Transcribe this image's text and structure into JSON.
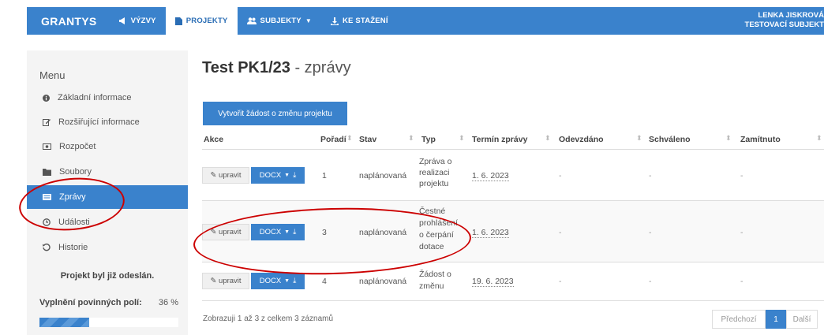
{
  "navbar": {
    "brand": "GRANTYS",
    "items": [
      {
        "label": "VÝZVY",
        "icon": "megaphone-icon"
      },
      {
        "label": "PROJEKTY",
        "icon": "file-icon",
        "active": true
      },
      {
        "label": "SUBJEKTY",
        "icon": "users-icon"
      },
      {
        "label": "KE STAŽENÍ",
        "icon": "download-icon"
      }
    ],
    "user_name": "LENKA JISKROVÁ",
    "user_subject": "TESTOVACÍ SUBJEKT"
  },
  "sidebar": {
    "title": "Menu",
    "items": [
      {
        "label": "Základní informace",
        "icon": "info-icon"
      },
      {
        "label": "Rozšiřující informace",
        "icon": "edit-icon"
      },
      {
        "label": "Rozpočet",
        "icon": "money-icon"
      },
      {
        "label": "Soubory",
        "icon": "folder-icon"
      },
      {
        "label": "Zprávy",
        "icon": "report-icon",
        "active": true
      },
      {
        "label": "Události",
        "icon": "clock-icon"
      },
      {
        "label": "Historie",
        "icon": "history-icon"
      }
    ],
    "sent_status": "Projekt byl již odeslán.",
    "progress_label": "Vyplnění povinných polí:",
    "progress_value": "36 %",
    "progress_fraction": 0.36
  },
  "main": {
    "title_bold": "Test PK1/23",
    "title_rest": " - zprávy",
    "create_button": "Vytvořit žádost o změnu projektu",
    "columns": [
      "Akce",
      "Pořadí",
      "Stav",
      "Typ",
      "Termín zprávy",
      "Odevzdáno",
      "Schváleno",
      "Zamítnuto"
    ],
    "edit_label": "upravit",
    "docx_label": "DOCX",
    "rows": [
      {
        "order": "1",
        "state": "naplánovaná",
        "type": [
          "Zpráva o",
          "realizaci",
          "projektu"
        ],
        "due": "1. 6. 2023",
        "submitted": "-",
        "approved": "-",
        "rejected": "-"
      },
      {
        "order": "3",
        "state": "naplánovaná",
        "type": [
          "Čestné",
          "prohlášení",
          "o čerpání",
          "dotace"
        ],
        "due": "1. 6. 2023",
        "submitted": "-",
        "approved": "-",
        "rejected": "-"
      },
      {
        "order": "4",
        "state": "naplánovaná",
        "type": [
          "Žádost o",
          "změnu"
        ],
        "due": "19. 6. 2023",
        "submitted": "-",
        "approved": "-",
        "rejected": "-"
      }
    ],
    "footer_text": "Zobrazuji 1 až 3 z celkem 3 záznamů",
    "pagination": {
      "prev": "Předchozí",
      "current": "1",
      "next": "Další"
    }
  },
  "colors": {
    "primary": "#3a82cc",
    "annotation": "#cc0000"
  }
}
